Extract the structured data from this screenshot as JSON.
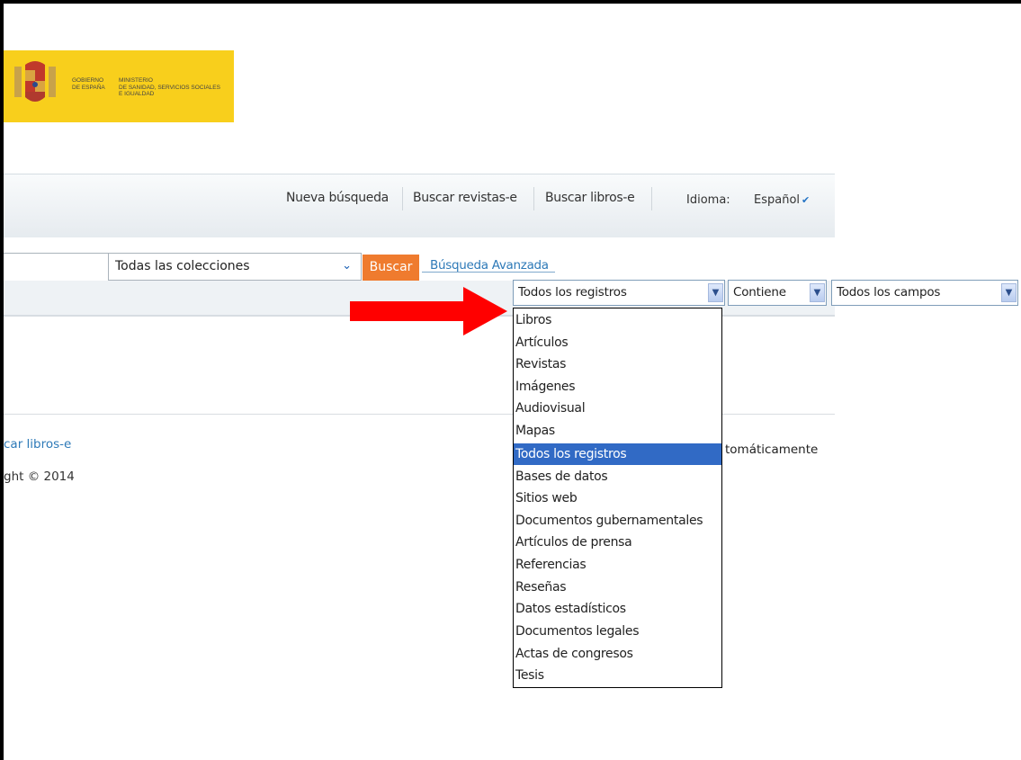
{
  "logo": {
    "government": "GOBIERNO\nDE ESPAÑA",
    "ministry": "MINISTERIO\nDE SANIDAD, SERVICIOS SOCIALES\nE IGUALDAD"
  },
  "nav": {
    "new_search": "Nueva búsqueda",
    "journals": "Buscar revistas-e",
    "books": "Buscar libros-e",
    "language_label": "Idioma:",
    "language_value": "Español"
  },
  "search": {
    "query": "",
    "collection": "Todas las colecciones",
    "button": "Buscar",
    "advanced": "Búsqueda Avanzada"
  },
  "filters": {
    "record_type": "Todos los registros",
    "operator": "Contiene",
    "field": "Todos los campos"
  },
  "record_type_options": [
    "Libros",
    "Artículos",
    "Revistas",
    "Imágenes",
    "Audiovisual",
    "Mapas",
    "Todos los registros",
    "Bases de datos",
    "Sitios web",
    "Documentos gubernamentales",
    "Artículos de prensa",
    "Referencias",
    "Reseñas",
    "Datos estadísticos",
    "Documentos legales",
    "Actas de congresos",
    "Tesis"
  ],
  "highlighted_option": "Todos los registros",
  "footer": {
    "link": "car libros-e",
    "copyright": "ght © 2014",
    "auto": "tomáticamente"
  },
  "colors": {
    "logo_bg": "#f8cf1c",
    "button_orange": "#ef7b2e",
    "selection_blue": "#316ac5",
    "link_blue": "#2e7ab8",
    "arrow_red": "#ff0000"
  }
}
